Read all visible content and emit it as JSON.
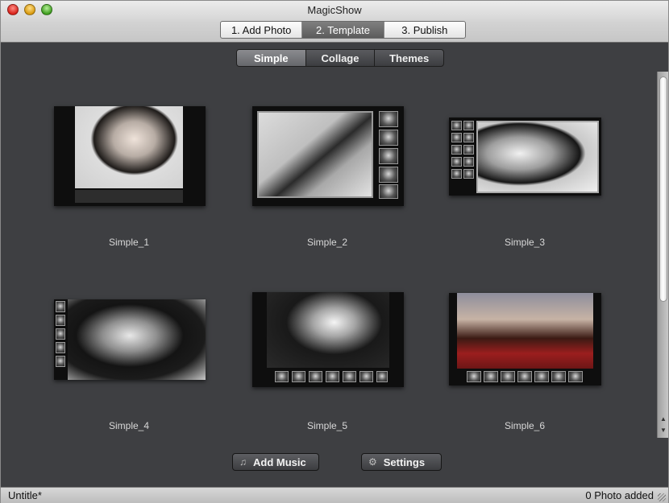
{
  "window": {
    "title": "MagicShow"
  },
  "steps": [
    {
      "label": "1. Add Photo",
      "active": false
    },
    {
      "label": "2. Template",
      "active": true
    },
    {
      "label": "3. Publish",
      "active": false
    }
  ],
  "categories": [
    {
      "label": "Simple",
      "active": true
    },
    {
      "label": "Collage",
      "active": false
    },
    {
      "label": "Themes",
      "active": false
    }
  ],
  "templates": [
    {
      "label": "Simple_1"
    },
    {
      "label": "Simple_2"
    },
    {
      "label": "Simple_3"
    },
    {
      "label": "Simple_4"
    },
    {
      "label": "Simple_5"
    },
    {
      "label": "Simple_6"
    }
  ],
  "buttons": {
    "add_music": "Add Music",
    "settings": "Settings"
  },
  "status": {
    "left": "Untitle*",
    "right": "0 Photo added"
  }
}
